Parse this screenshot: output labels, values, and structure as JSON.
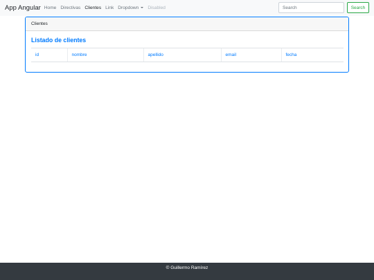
{
  "navbar": {
    "brand": "App Angular",
    "links": [
      {
        "label": "Home"
      },
      {
        "label": "Directivas"
      },
      {
        "label": "Clientes"
      },
      {
        "label": "Link"
      },
      {
        "label": "Dropdown"
      },
      {
        "label": "Disabled"
      }
    ],
    "search_placeholder": "Search",
    "search_button": "Search"
  },
  "card": {
    "header": "Clientes",
    "title": "Listado de clientes",
    "table": {
      "columns": [
        "id",
        "nombre",
        "apellido",
        "email",
        "fecha"
      ],
      "rows": []
    }
  },
  "footer": {
    "text": "© Guillermo Ramírez"
  },
  "colors": {
    "primary": "#007bff",
    "success": "#28a745",
    "footer_bg": "#343a40"
  }
}
